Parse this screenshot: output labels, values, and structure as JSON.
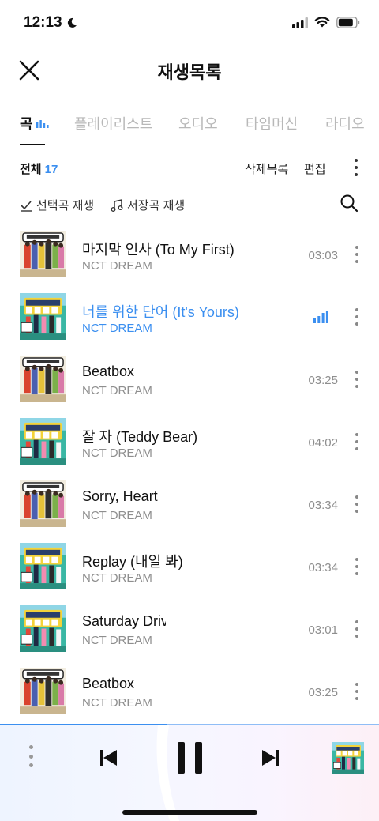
{
  "status": {
    "time": "12:13"
  },
  "header": {
    "title": "재생목록"
  },
  "tabs": [
    {
      "label": "곡",
      "active": true
    },
    {
      "label": "플레이리스트"
    },
    {
      "label": "오디오"
    },
    {
      "label": "타임머신"
    },
    {
      "label": "라디오"
    }
  ],
  "toolbar": {
    "total_label": "전체",
    "total_count": "17",
    "delete_label": "삭제목록",
    "edit_label": "편집"
  },
  "actions": {
    "play_selected": "선택곡 재생",
    "play_saved": "저장곡 재생"
  },
  "songs": [
    {
      "title": "마지막 인사 (To My First)",
      "artist": "NCT DREAM",
      "duration": "03:03",
      "album": "beatbox",
      "playing": false
    },
    {
      "title": "너를 위한 단어 (It's Yours)",
      "artist": "NCT DREAM",
      "duration": "",
      "album": "glitch",
      "playing": true
    },
    {
      "title": "Beatbox",
      "artist": "NCT DREAM",
      "duration": "03:25",
      "album": "beatbox",
      "playing": false
    },
    {
      "title": "잘 자 (Teddy Bear)",
      "artist": "NCT DREAM",
      "duration": "04:02",
      "album": "glitch",
      "playing": false
    },
    {
      "title": "Sorry, Heart",
      "artist": "NCT DREAM",
      "duration": "03:34",
      "album": "beatbox",
      "playing": false
    },
    {
      "title": "Replay (내일 봐)",
      "artist": "NCT DREAM",
      "duration": "03:34",
      "album": "glitch",
      "playing": false
    },
    {
      "title": "Saturday Drive",
      "artist": "NCT DREAM",
      "duration": "03:01",
      "album": "glitch",
      "playing": false
    },
    {
      "title": "Beatbox",
      "artist": "NCT DREAM",
      "duration": "03:25",
      "album": "beatbox",
      "playing": false
    }
  ],
  "colors": {
    "accent": "#3b8ff0",
    "muted": "#8e8e8e",
    "tab_inactive": "#b8b8b8"
  },
  "player": {
    "state": "playing"
  }
}
